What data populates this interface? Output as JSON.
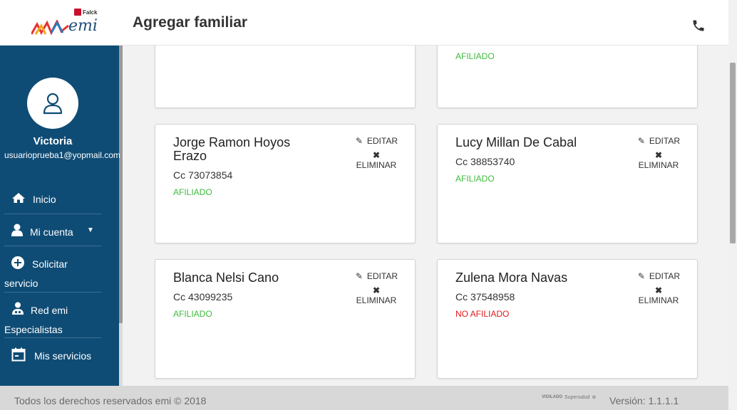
{
  "header": {
    "brand_small": "Falck",
    "brand": "emi",
    "title": "Agregar familiar"
  },
  "sidebar": {
    "user_name": "Victoria",
    "user_email": "usuarioprueba1@yopmail.com",
    "items": [
      {
        "label": "Inicio",
        "icon": "home-icon"
      },
      {
        "label": "Mi cuenta",
        "icon": "user-icon"
      },
      {
        "label_line1": "Solicitar",
        "label_line2": "servicio",
        "icon": "plus-circle-icon"
      },
      {
        "label_line1": "Red emi",
        "label_line2": "Especialistas",
        "icon": "doctor-icon"
      },
      {
        "label": "Mis servicios",
        "icon": "calendar-icon"
      }
    ]
  },
  "cards": {
    "edit_label": "EDITAR",
    "delete_label": "ELIMINAR",
    "top_right_status": "AFILIADO",
    "members": [
      {
        "name": "Jorge Ramon Hoyos Erazo",
        "id": "Cc 73073854",
        "status": "AFILIADO"
      },
      {
        "name": "Lucy Millan De Cabal",
        "id": "Cc 38853740",
        "status": "AFILIADO"
      },
      {
        "name": "Blanca Nelsi Cano",
        "id": "Cc 43099235",
        "status": "AFILIADO"
      },
      {
        "name": "Zulena Mora Navas",
        "id": "Cc 37548958",
        "status": "NO AFILIADO"
      }
    ]
  },
  "footer": {
    "rights": "Todos los derechos reservados emi © 2018",
    "vigilado": "VIGILADO",
    "supersalud": "Supersalud",
    "version": "Versión: 1.1.1.1"
  },
  "colors": {
    "sidebar": "#0f4c75",
    "affiliated": "#3dbb3d",
    "not_affiliated": "#e31b1b"
  }
}
